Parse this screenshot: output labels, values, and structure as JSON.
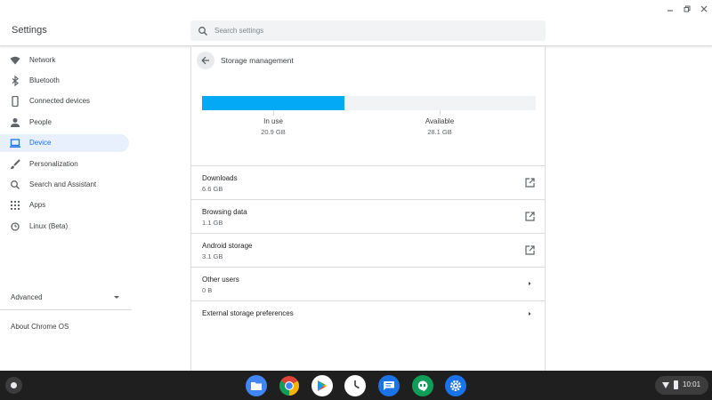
{
  "window": {
    "title": "Settings",
    "controls": [
      "minimize-icon",
      "restore-icon",
      "close-icon"
    ]
  },
  "search": {
    "placeholder": "Search settings",
    "value": ""
  },
  "sidebar": {
    "items": [
      {
        "label": "Network",
        "icon": "wifi-icon",
        "active": false
      },
      {
        "label": "Bluetooth",
        "icon": "bluetooth-icon",
        "active": false
      },
      {
        "label": "Connected devices",
        "icon": "phone-icon",
        "active": false
      },
      {
        "label": "People",
        "icon": "person-icon",
        "active": false
      },
      {
        "label": "Device",
        "icon": "laptop-icon",
        "active": true
      },
      {
        "label": "Personalization",
        "icon": "brush-icon",
        "active": false
      },
      {
        "label": "Search and Assistant",
        "icon": "search-icon",
        "active": false
      },
      {
        "label": "Apps",
        "icon": "apps-grid-icon",
        "active": false
      },
      {
        "label": "Linux (Beta)",
        "icon": "linux-icon",
        "active": false
      }
    ],
    "advanced_label": "Advanced",
    "about_label": "About Chrome OS"
  },
  "page": {
    "title": "Storage management",
    "in_use_label": "In use",
    "in_use_value": "20.9 GB",
    "available_label": "Available",
    "available_value": "28.1 GB",
    "usage_fraction": 0.427,
    "rows": [
      {
        "label": "Downloads",
        "value": "6.6 GB",
        "icon": "open-in-new-icon"
      },
      {
        "label": "Browsing data",
        "value": "1.1 GB",
        "icon": "open-in-new-icon"
      },
      {
        "label": "Android storage",
        "value": "3.1 GB",
        "icon": "open-in-new-icon"
      },
      {
        "label": "Other users",
        "value": "0 B",
        "icon": "chevron-right-icon"
      },
      {
        "label": "External storage preferences",
        "value": "",
        "icon": "chevron-right-icon"
      }
    ]
  },
  "shelf": {
    "apps": [
      "files-icon",
      "chrome-icon",
      "play-store-icon",
      "clock-icon",
      "messages-icon",
      "hangouts-icon",
      "settings-icon"
    ],
    "time": "10:01"
  },
  "colors": {
    "accent": "#1a73e8",
    "usage_bar": "#03a9f4",
    "shelf": "#1f1f1f"
  }
}
